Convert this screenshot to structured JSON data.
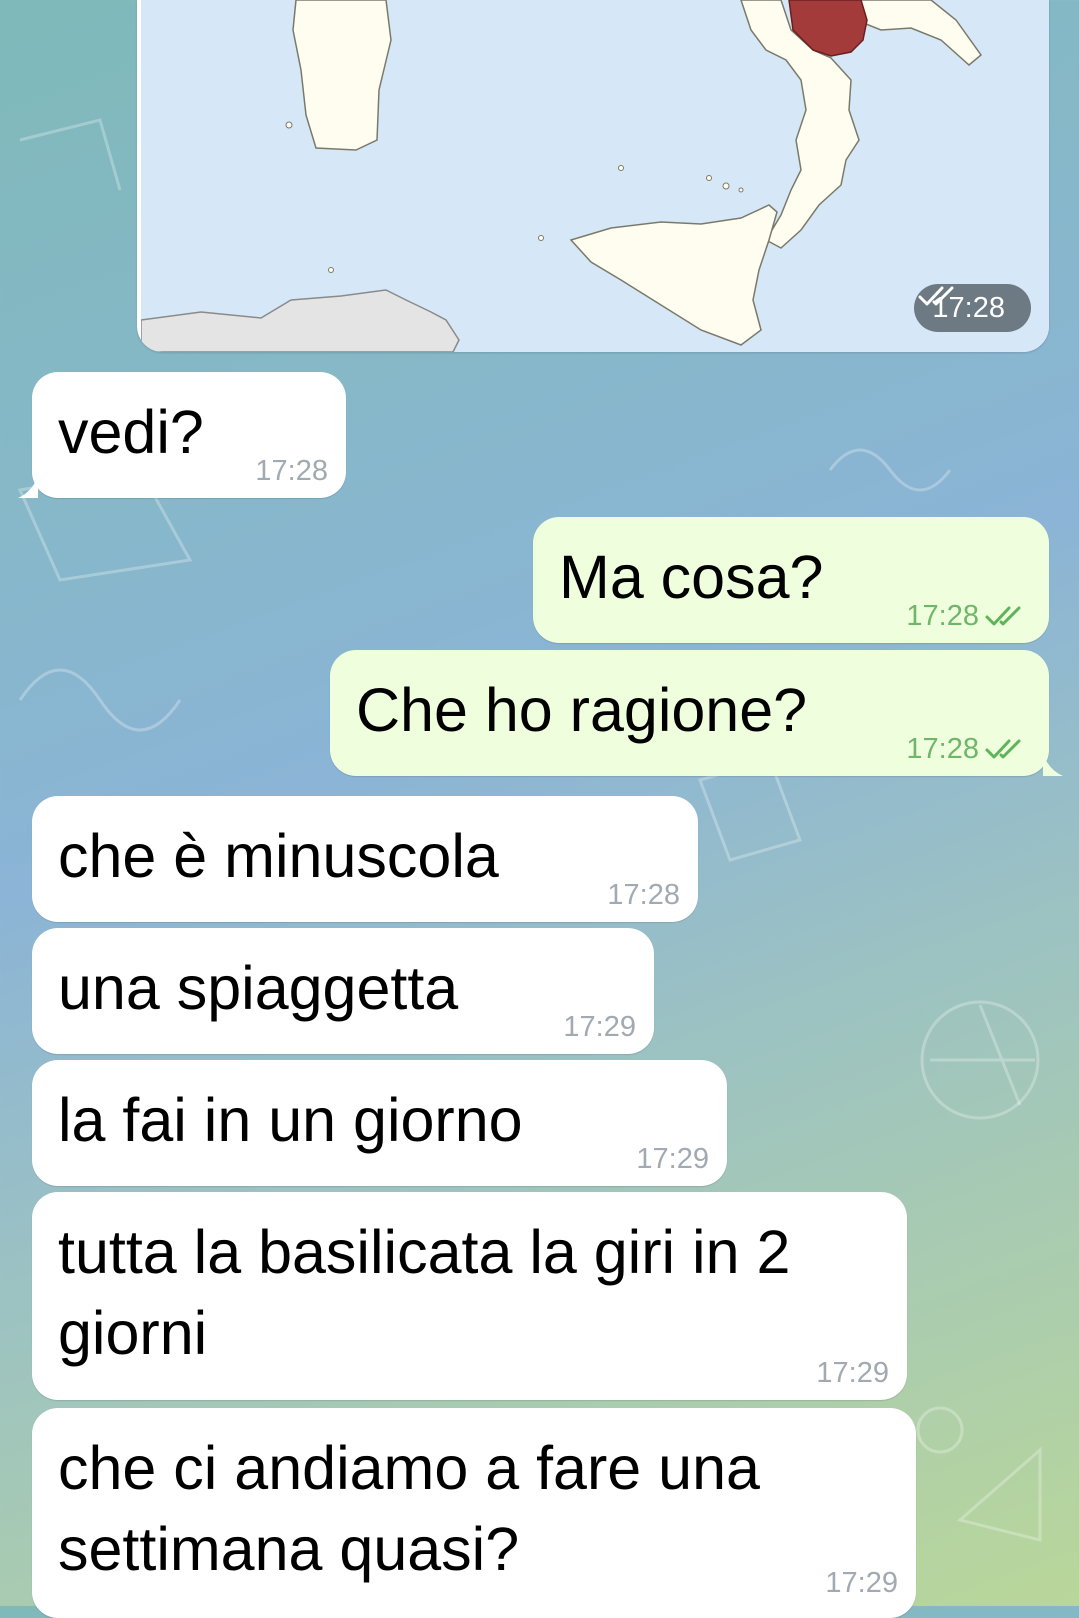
{
  "map_message": {
    "time": "17:28",
    "status_icon": "double-check-icon",
    "region_color": "#a33b3b",
    "sea_color": "#d6e7f8",
    "land_color": "#fffdf0"
  },
  "messages": [
    {
      "side": "in",
      "text": "vedi?",
      "time": "17:28"
    },
    {
      "side": "out",
      "text": "Ma cosa?",
      "time": "17:28"
    },
    {
      "side": "out",
      "text": "Che ho ragione?",
      "time": "17:28"
    },
    {
      "side": "in",
      "text": "che è minuscola",
      "time": "17:28"
    },
    {
      "side": "in",
      "text": "una spiaggetta",
      "time": "17:29"
    },
    {
      "side": "in",
      "text": "la fai in un giorno",
      "time": "17:29"
    },
    {
      "side": "in",
      "text": "tutta la basilicata la giri in 2 giorni",
      "time": "17:29"
    },
    {
      "side": "in",
      "text": "che ci andiamo a fare una settimana quasi?",
      "time": "17:29"
    }
  ],
  "colors": {
    "incoming_bubble": "#ffffff",
    "outgoing_bubble": "#effedd",
    "read_ticks": "#5fb35a"
  }
}
